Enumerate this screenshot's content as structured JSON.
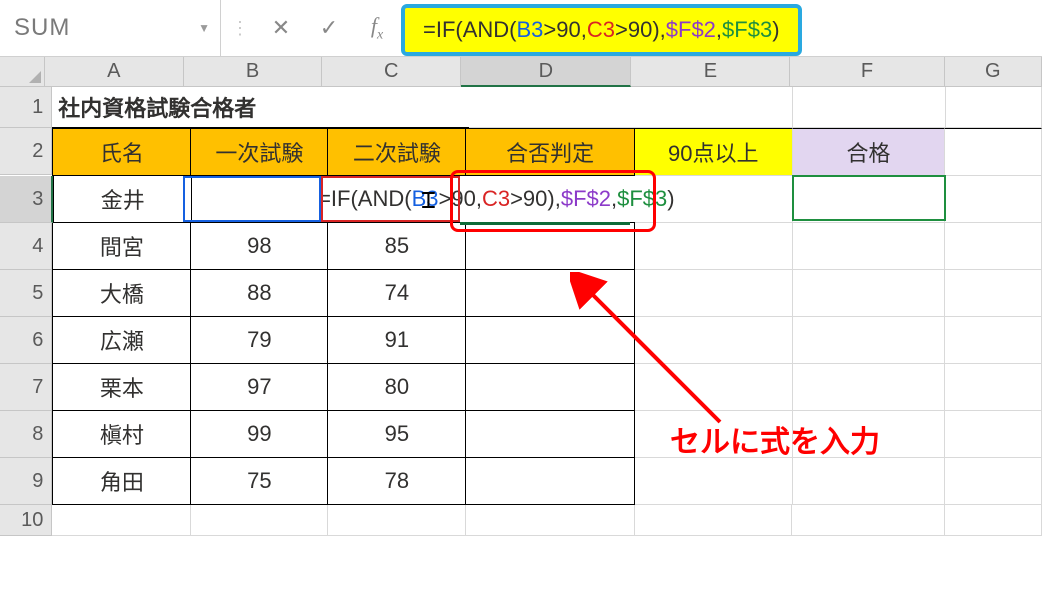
{
  "namebox": "SUM",
  "formula_bar": {
    "prefix": "=IF(AND(",
    "b3": "B3",
    "gt90a": ">90,",
    "c3": "C3",
    "gt90b": ">90",
    "close_and": "),",
    "f2": "$F$2",
    "comma": ",",
    "f3": "$F$3",
    "after": ")"
  },
  "cols": [
    "A",
    "B",
    "C",
    "D",
    "E",
    "F",
    "G"
  ],
  "rows": [
    "1",
    "2",
    "3",
    "4",
    "5",
    "6",
    "7",
    "8",
    "9",
    "10"
  ],
  "title": "社内資格試験合格者",
  "head": {
    "a": "氏名",
    "b": "一次試験",
    "c": "二次試験",
    "d": "合否判定",
    "e": "90点以上",
    "f": "合格"
  },
  "cell_edit": {
    "prefix": "=IF(AND(",
    "b3": "B3",
    "mid1": ">90,",
    "c3": "C3",
    "mid2": ">90)",
    "comma": ",",
    "f2": "$F$2",
    "comma2": ",",
    "f3": "$F$3",
    "end": ")"
  },
  "r": [
    {
      "a": "金井",
      "b": "",
      "c": ""
    },
    {
      "a": "間宮",
      "b": "98",
      "c": "85"
    },
    {
      "a": "大橋",
      "b": "88",
      "c": "74"
    },
    {
      "a": "広瀬",
      "b": "79",
      "c": "91"
    },
    {
      "a": "栗本",
      "b": "97",
      "c": "80"
    },
    {
      "a": "槇村",
      "b": "99",
      "c": "95"
    },
    {
      "a": "角田",
      "b": "75",
      "c": "78"
    }
  ],
  "caption": "セルに式を入力"
}
